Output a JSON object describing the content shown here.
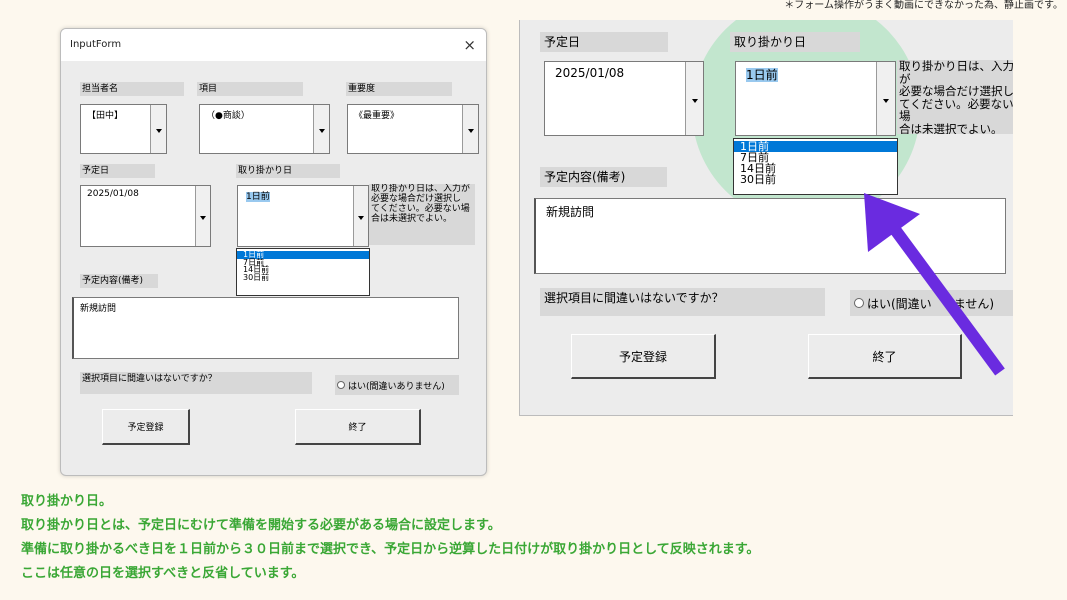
{
  "note": "＊フォーム操作がうまく動画にできなかった為、静止画です。",
  "form": {
    "title": "InputForm",
    "close_glyph": "×",
    "labels": {
      "person": "担当者名",
      "item": "項目",
      "importance": "重要度",
      "date": "予定日",
      "prep": "取り掛かり日",
      "memo": "予定内容(備考)",
      "confirm": "選択項目に間違いはないですか？"
    },
    "values": {
      "person": "【田中】",
      "item": "（●商談）",
      "importance": "《最重要》",
      "date": "2025/01/08",
      "prep": "1日前",
      "memo": "新規訪問"
    },
    "prep_options": [
      "1日前",
      "7日前",
      "14日前",
      "30日前"
    ],
    "help_lines": [
      "取り掛かり日は、入力が",
      "必要な場合だけ選択し",
      "てください。必要ない場",
      "合は未選択でよい。"
    ],
    "radio_label": "はい(間違いありません)",
    "register_button": "予定登録",
    "close_button": "終了"
  },
  "zoom": {
    "radio_left": "はい(間違い",
    "radio_right": "ません)"
  },
  "colors": {
    "caption": "#3aa735",
    "highlight_circle": "#91e1aa",
    "arrow": "#6a2be0",
    "list_selected": "#0078d7"
  },
  "icons": {
    "close": "close-icon",
    "dropdown": "chevron-down-icon",
    "arrow": "pointer-arrow-icon"
  },
  "caption": [
    "取り掛かり日。",
    "取り掛かり日とは、予定日にむけて準備を開始する必要がある場合に設定します。",
    "準備に取り掛かるべき日を１日前から３０日前まで選択でき、予定日から逆算した日付けが取り掛かり日として反映されます。",
    "ここは任意の日を選択すべきと反省しています。"
  ]
}
